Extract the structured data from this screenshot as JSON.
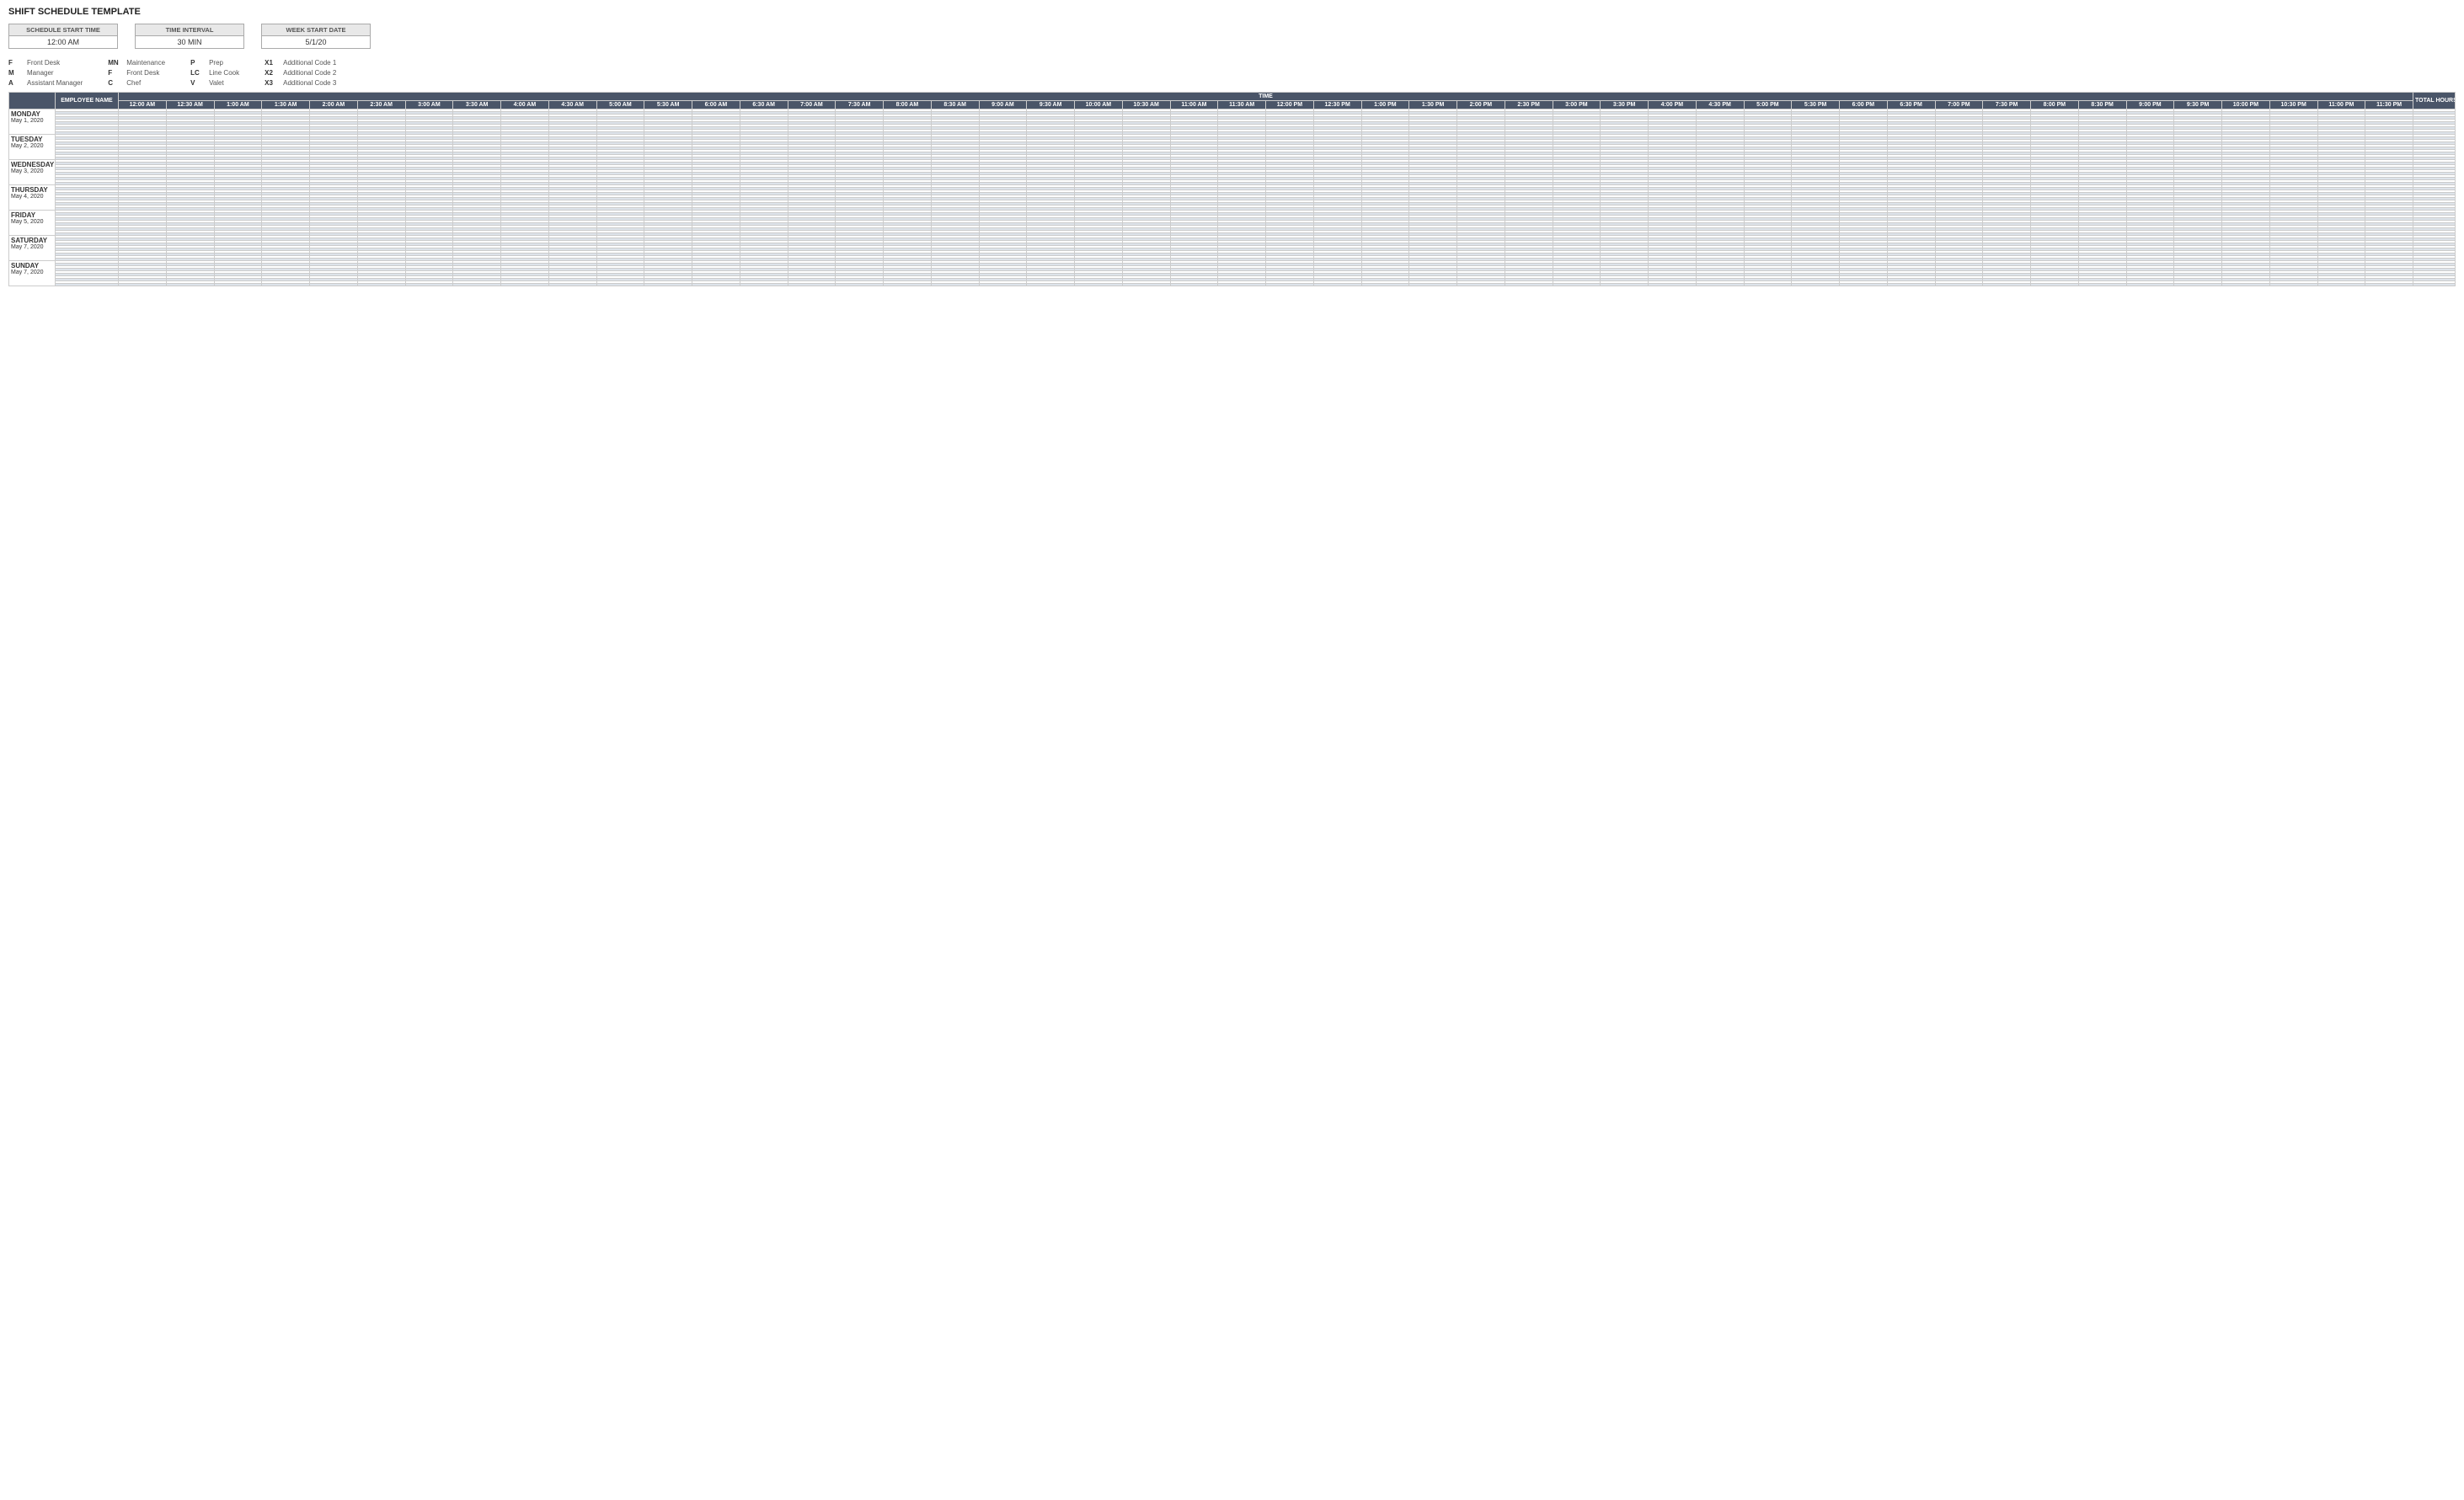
{
  "title": "SHIFT SCHEDULE TEMPLATE",
  "config": {
    "schedule_start_time_label": "SCHEDULE START TIME",
    "schedule_start_time_value": "12:00 AM",
    "time_interval_label": "TIME INTERVAL",
    "time_interval_value": "30 MIN",
    "week_start_date_label": "WEEK START DATE",
    "week_start_date_value": "5/1/20"
  },
  "legend": {
    "col1": [
      {
        "code": "F",
        "text": "Front Desk"
      },
      {
        "code": "M",
        "text": "Manager"
      },
      {
        "code": "A",
        "text": "Assistant Manager"
      }
    ],
    "col2": [
      {
        "code": "MN",
        "text": "Maintenance"
      },
      {
        "code": "F",
        "text": "Front Desk"
      },
      {
        "code": "C",
        "text": "Chef"
      }
    ],
    "col3": [
      {
        "code": "P",
        "text": "Prep"
      },
      {
        "code": "LC",
        "text": "Line Cook"
      },
      {
        "code": "V",
        "text": "Valet"
      }
    ],
    "col4": [
      {
        "code": "X1",
        "text": "Additional Code 1"
      },
      {
        "code": "X2",
        "text": "Additional Code 2"
      },
      {
        "code": "X3",
        "text": "Additional Code 3"
      }
    ]
  },
  "headers": {
    "employee_name": "EMPLOYEE NAME",
    "time": "TIME",
    "total_hours": "TOTAL HOURS PER SHIFT"
  },
  "time_slots": [
    "12:00 AM",
    "12:30 AM",
    "1:00 AM",
    "1:30 AM",
    "2:00 AM",
    "2:30 AM",
    "3:00 AM",
    "3:30 AM",
    "4:00 AM",
    "4:30 AM",
    "5:00 AM",
    "5:30 AM",
    "6:00 AM",
    "6:30 AM",
    "7:00 AM",
    "7:30 AM",
    "8:00 AM",
    "8:30 AM",
    "9:00 AM",
    "9:30 AM",
    "10:00 AM",
    "10:30 AM",
    "11:00 AM",
    "11:30 AM",
    "12:00 PM",
    "12:30 PM",
    "1:00 PM",
    "1:30 PM",
    "2:00 PM",
    "2:30 PM",
    "3:00 PM",
    "3:30 PM",
    "4:00 PM",
    "4:30 PM",
    "5:00 PM",
    "5:30 PM",
    "6:00 PM",
    "6:30 PM",
    "7:00 PM",
    "7:30 PM",
    "8:00 PM",
    "8:30 PM",
    "9:00 PM",
    "9:30 PM",
    "10:00 PM",
    "10:30 PM",
    "11:00 PM",
    "11:30 PM"
  ],
  "days": [
    {
      "name": "MONDAY",
      "date": "May 1, 2020",
      "rows": 10
    },
    {
      "name": "TUESDAY",
      "date": "May 2, 2020",
      "rows": 10
    },
    {
      "name": "WEDNESDAY",
      "date": "May 3, 2020",
      "rows": 10
    },
    {
      "name": "THURSDAY",
      "date": "May 4, 2020",
      "rows": 10
    },
    {
      "name": "FRIDAY",
      "date": "May 5, 2020",
      "rows": 10
    },
    {
      "name": "SATURDAY",
      "date": "May 7, 2020",
      "rows": 10
    },
    {
      "name": "SUNDAY",
      "date": "May 7, 2020",
      "rows": 10
    }
  ]
}
